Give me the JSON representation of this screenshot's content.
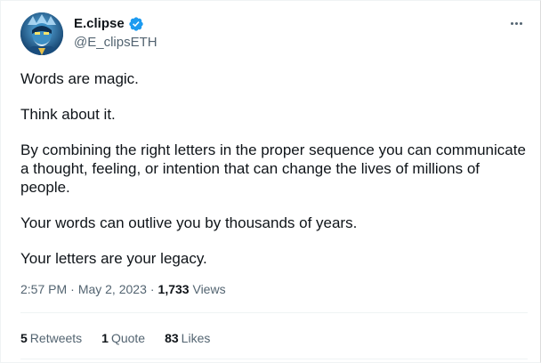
{
  "author": {
    "display_name": "E.clipse",
    "handle": "@E_clipsETH",
    "verified": true
  },
  "tweet": {
    "paragraphs": [
      "Words are magic.",
      "Think about it.",
      "By combining the right letters in the proper sequence you can communicate a thought, feeling, or intention that can change the lives of millions of people.",
      "Your words can outlive you by thousands of years.",
      "Your letters are your legacy."
    ]
  },
  "meta": {
    "time": "2:57 PM",
    "separator": "·",
    "date": "May 2, 2023",
    "views_count": "1,733",
    "views_label": "Views"
  },
  "stats": {
    "retweets": {
      "count": "5",
      "label": "Retweets"
    },
    "quotes": {
      "count": "1",
      "label": "Quote"
    },
    "likes": {
      "count": "83",
      "label": "Likes"
    }
  },
  "colors": {
    "accent": "#1d9bf0",
    "text_primary": "#0f1419",
    "text_secondary": "#536471",
    "divider": "#eff3f4"
  },
  "icons": {
    "verified": "verified-badge-icon",
    "more": "more-options-icon"
  }
}
